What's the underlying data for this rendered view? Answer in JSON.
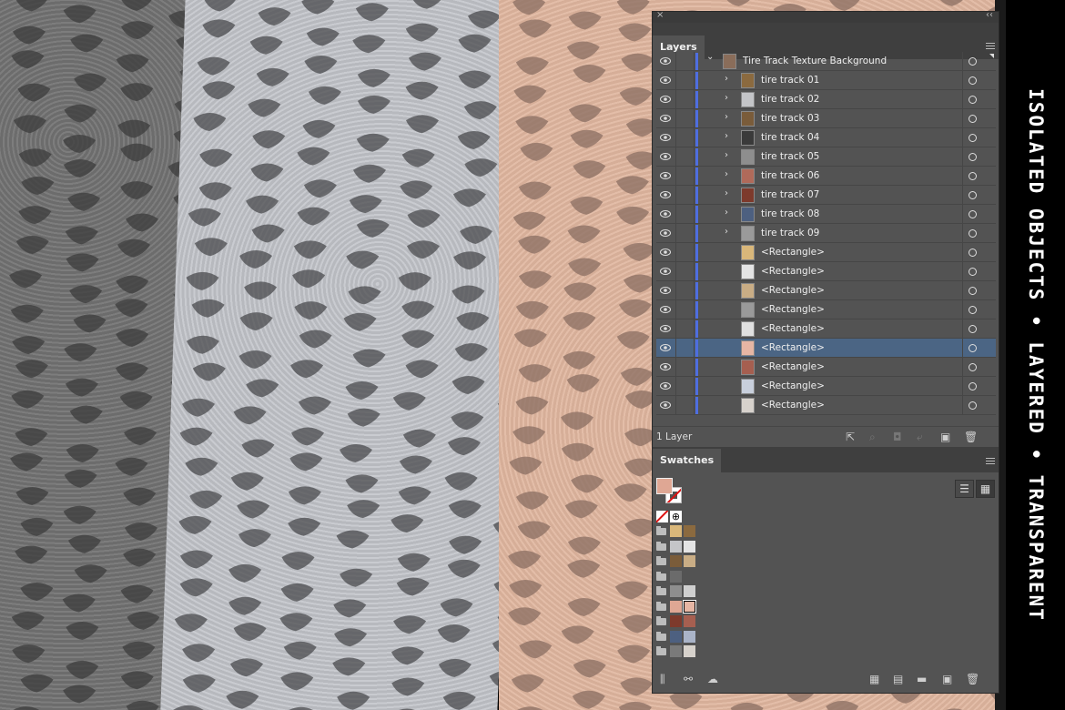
{
  "banner": {
    "text": "ISOLATED OBJECTS • LAYERED • TRANSPARENT"
  },
  "panel": {
    "close_glyph": "×",
    "collapse_glyph": "‹‹",
    "layers": {
      "tab_label": "Layers",
      "rows": [
        {
          "name": "Tire Track Texture Background",
          "level": 0,
          "expandable": true,
          "expanded": true,
          "thumb": "#8a6d5a",
          "selected": false
        },
        {
          "name": "tire track 01",
          "level": 1,
          "expandable": true,
          "expanded": false,
          "thumb": "#8b6a3f",
          "selected": false
        },
        {
          "name": "tire track 02",
          "level": 1,
          "expandable": true,
          "expanded": false,
          "thumb": "#c4c5c8",
          "selected": false
        },
        {
          "name": "tire track 03",
          "level": 1,
          "expandable": true,
          "expanded": false,
          "thumb": "#7a5c3a",
          "selected": false
        },
        {
          "name": "tire track 04",
          "level": 1,
          "expandable": true,
          "expanded": false,
          "thumb": "#3a3a3a",
          "selected": false
        },
        {
          "name": "tire track 05",
          "level": 1,
          "expandable": true,
          "expanded": false,
          "thumb": "#8e8e8e",
          "selected": false
        },
        {
          "name": "tire track 06",
          "level": 1,
          "expandable": true,
          "expanded": false,
          "thumb": "#b06a5a",
          "selected": false
        },
        {
          "name": "tire track 07",
          "level": 1,
          "expandable": true,
          "expanded": false,
          "thumb": "#7d3a2c",
          "selected": false
        },
        {
          "name": "tire track 08",
          "level": 1,
          "expandable": true,
          "expanded": false,
          "thumb": "#4d6080",
          "selected": false
        },
        {
          "name": "tire track 09",
          "level": 1,
          "expandable": true,
          "expanded": false,
          "thumb": "#9a9a9a",
          "selected": false
        },
        {
          "name": "<Rectangle>",
          "level": 1,
          "expandable": false,
          "expanded": false,
          "thumb": "#d9b77a",
          "selected": false
        },
        {
          "name": "<Rectangle>",
          "level": 1,
          "expandable": false,
          "expanded": false,
          "thumb": "#e4e4e4",
          "selected": false
        },
        {
          "name": "<Rectangle>",
          "level": 1,
          "expandable": false,
          "expanded": false,
          "thumb": "#c9ad85",
          "selected": false
        },
        {
          "name": "<Rectangle>",
          "level": 1,
          "expandable": false,
          "expanded": false,
          "thumb": "#9a9a9a",
          "selected": false
        },
        {
          "name": "<Rectangle>",
          "level": 1,
          "expandable": false,
          "expanded": false,
          "thumb": "#e0e0e0",
          "selected": false
        },
        {
          "name": "<Rectangle>",
          "level": 1,
          "expandable": false,
          "expanded": false,
          "thumb": "#e6b6a4",
          "selected": true
        },
        {
          "name": "<Rectangle>",
          "level": 1,
          "expandable": false,
          "expanded": false,
          "thumb": "#a65f50",
          "selected": false
        },
        {
          "name": "<Rectangle>",
          "level": 1,
          "expandable": false,
          "expanded": false,
          "thumb": "#c8cfdc",
          "selected": false
        },
        {
          "name": "<Rectangle>",
          "level": 1,
          "expandable": false,
          "expanded": false,
          "thumb": "#d7d2cc",
          "selected": false
        }
      ],
      "footer": {
        "count_label": "1 Layer",
        "icons": [
          {
            "name": "export-icon",
            "glyph": "⇱",
            "enabled": true
          },
          {
            "name": "locate-object-icon",
            "glyph": "⌕",
            "enabled": false
          },
          {
            "name": "make-clipping-mask-icon",
            "glyph": "◘",
            "enabled": false
          },
          {
            "name": "new-sublayer-icon",
            "glyph": "⤶",
            "enabled": false
          },
          {
            "name": "new-layer-icon",
            "glyph": "▣",
            "enabled": true
          },
          {
            "name": "delete-icon",
            "glyph": "🗑",
            "enabled": true
          }
        ]
      }
    },
    "swatches": {
      "tab_label": "Swatches",
      "fill_color": "#dfa794",
      "view_buttons": [
        {
          "name": "list-view-icon",
          "glyph": "☰",
          "active": false
        },
        {
          "name": "grid-view-icon",
          "glyph": "▦",
          "active": true
        }
      ],
      "groups": [
        {
          "chips": [
            "#d9b77a",
            "#8b6a3f"
          ]
        },
        {
          "chips": [
            "#c4c5c8",
            "#e4e4e4"
          ]
        },
        {
          "chips": [
            "#7a5c3a",
            "#c9ad85"
          ]
        },
        {
          "chips": [
            "#6b6b6b"
          ]
        },
        {
          "chips": [
            "#8e8e8e",
            "#cfcfcf"
          ]
        },
        {
          "chips": [
            "#dfa794",
            "#e6b6a4"
          ],
          "selected_index": 1
        },
        {
          "chips": [
            "#7d3a2c",
            "#a65f50"
          ]
        },
        {
          "chips": [
            "#4d6080",
            "#aab4c8"
          ]
        },
        {
          "chips": [
            "#7a7a7a",
            "#d7d2cc"
          ]
        }
      ],
      "footer_icons": [
        {
          "name": "swatch-libraries-icon",
          "glyph": "⫼"
        },
        {
          "name": "cc-libraries-icon",
          "glyph": "⚯"
        },
        {
          "name": "cloud-icon",
          "glyph": "☁"
        },
        {
          "name": "show-swatch-kinds-icon",
          "glyph": "▦"
        },
        {
          "name": "swatch-options-icon",
          "glyph": "▤"
        },
        {
          "name": "new-color-group-icon",
          "glyph": "▬"
        },
        {
          "name": "new-swatch-icon",
          "glyph": "▣"
        },
        {
          "name": "delete-swatch-icon",
          "glyph": "🗑"
        }
      ]
    }
  }
}
